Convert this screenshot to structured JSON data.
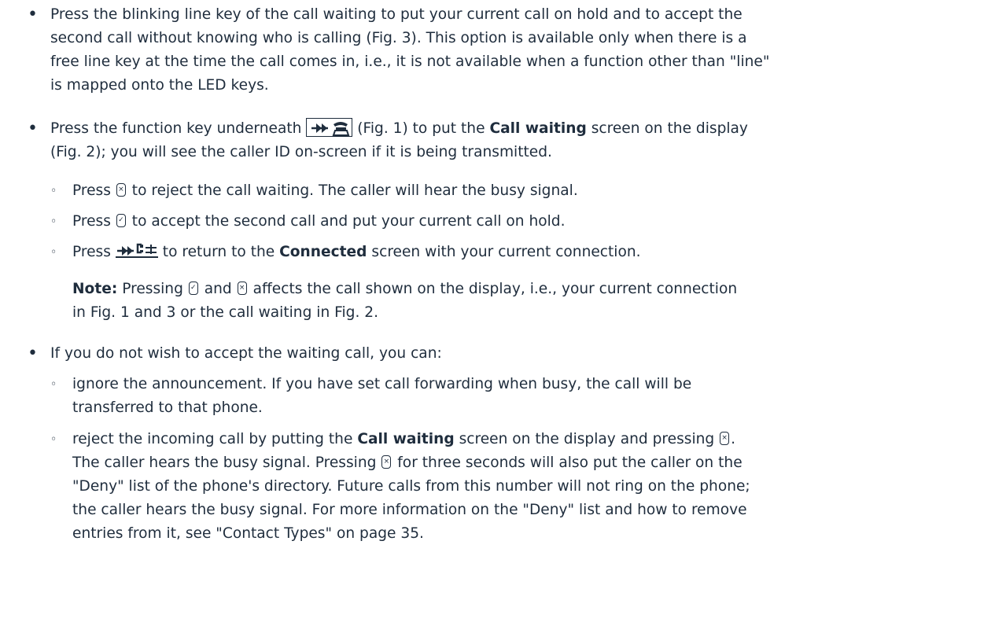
{
  "p1": {
    "l1": "Press the blinking line key of the call waiting to put your current call on hold and to accept the",
    "l2": "second call without knowing who is calling (Fig. 3).  This option is available only when there is a",
    "l3": "free line key at the time the call comes in, i.e., it is not available when a function other than \"line\"",
    "l4": "is mapped onto the LED keys."
  },
  "p2": {
    "a": "Press the function key underneath",
    "b": "(Fig. 1) to put the",
    "bold": "Call waiting",
    "c": "screen on the display",
    "l2": "(Fig. 2); you will see the caller ID on-screen if it is being transmitted."
  },
  "s1": {
    "a": "Press",
    "b": "to reject the call waiting.  The caller will hear the busy signal."
  },
  "s2": {
    "a": "Press",
    "b": "to accept the second call and put your current call on hold."
  },
  "s3": {
    "a": "Press",
    "b": "to return to the",
    "bold": "Connected",
    "c": "screen with your current connection."
  },
  "note": {
    "label": "Note:",
    "a": "Pressing",
    "b": "and",
    "c": "affects the call shown on the display, i.e., your current connection",
    "l2": "in Fig. 1 and 3 or the call waiting in Fig. 2."
  },
  "p3": {
    "l1": "If you do not wish to accept the waiting call, you can:"
  },
  "s4": {
    "l1": "ignore the announcement.  If you have set call forwarding when busy, the call will be",
    "l2": "transferred to that phone."
  },
  "s5": {
    "a": "reject the incoming call by putting the",
    "bold": "Call waiting",
    "b": "screen on the display and pressing",
    "c": ".",
    "l2a": "The caller hears the busy signal.  Pressing",
    "l2b": "for three seconds will also put the caller on the",
    "l3": "\"Deny\" list of the phone's directory.  Future calls from this number will not ring on the phone;",
    "l4": "the caller hears the busy signal.  For more information on the \"Deny\" list and how to remove",
    "l5": "entries from it, see \"Contact Types\" on page 35."
  },
  "icons": {
    "accept": "accept-key-icon",
    "reject": "reject-key-icon",
    "call_waiting_fkey": "call-waiting-function-key-icon",
    "connected_fkey": "connected-function-key-icon"
  }
}
